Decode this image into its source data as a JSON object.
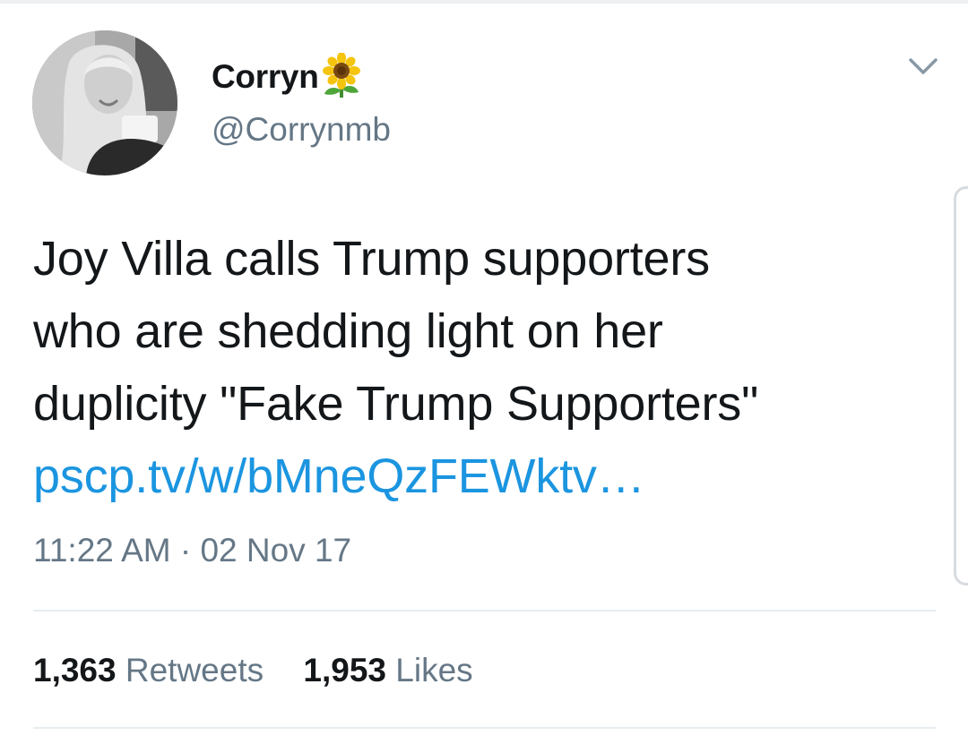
{
  "tweet": {
    "author": {
      "display_name": "Corryn",
      "name_emoji": "sunflower-icon",
      "handle": "@Corrynmb",
      "avatar": "profile-photo"
    },
    "text_lines": [
      "Joy Villa calls Trump supporters",
      "who are shedding light on her",
      "duplicity \"Fake Trump Supporters\""
    ],
    "link": "pscp.tv/w/bMneQzFEWktv…",
    "timestamp": "11:22 AM · 02 Nov 17",
    "stats": {
      "retweets_count": "1,363",
      "retweets_label": "Retweets",
      "likes_count": "1,953",
      "likes_label": "Likes"
    },
    "menu_icon": "chevron-down-icon"
  },
  "colors": {
    "text_primary": "#14171a",
    "text_secondary": "#657786",
    "link": "#1b95e0",
    "divider": "#e6ecf0"
  }
}
